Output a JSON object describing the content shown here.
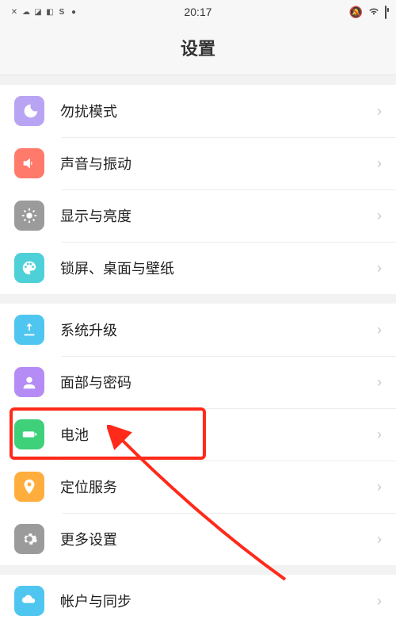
{
  "status": {
    "time": "20:17"
  },
  "header": {
    "title": "设置"
  },
  "groups": [
    {
      "items": [
        {
          "key": "dnd",
          "label": "勿扰模式"
        },
        {
          "key": "sound",
          "label": "声音与振动"
        },
        {
          "key": "display",
          "label": "显示与亮度"
        },
        {
          "key": "wallpaper",
          "label": "锁屏、桌面与壁纸"
        }
      ]
    },
    {
      "items": [
        {
          "key": "update",
          "label": "系统升级"
        },
        {
          "key": "face",
          "label": "面部与密码"
        },
        {
          "key": "battery",
          "label": "电池"
        },
        {
          "key": "location",
          "label": "定位服务"
        },
        {
          "key": "more",
          "label": "更多设置"
        }
      ]
    },
    {
      "items": [
        {
          "key": "account",
          "label": "帐户与同步"
        }
      ]
    }
  ],
  "icons": {
    "dnd": {
      "bg": "#b9a4f4"
    },
    "sound": {
      "bg": "#ff7a6b"
    },
    "display": {
      "bg": "#9b9b9b"
    },
    "wallpaper": {
      "bg": "#4ed0d8"
    },
    "update": {
      "bg": "#4fc6f0"
    },
    "face": {
      "bg": "#b58cf5"
    },
    "battery": {
      "bg": "#3fd07a"
    },
    "location": {
      "bg": "#ffae3d"
    },
    "more": {
      "bg": "#9b9b9b"
    },
    "account": {
      "bg": "#4fc6f0"
    }
  },
  "annotation": {
    "highlight_item": "battery"
  }
}
